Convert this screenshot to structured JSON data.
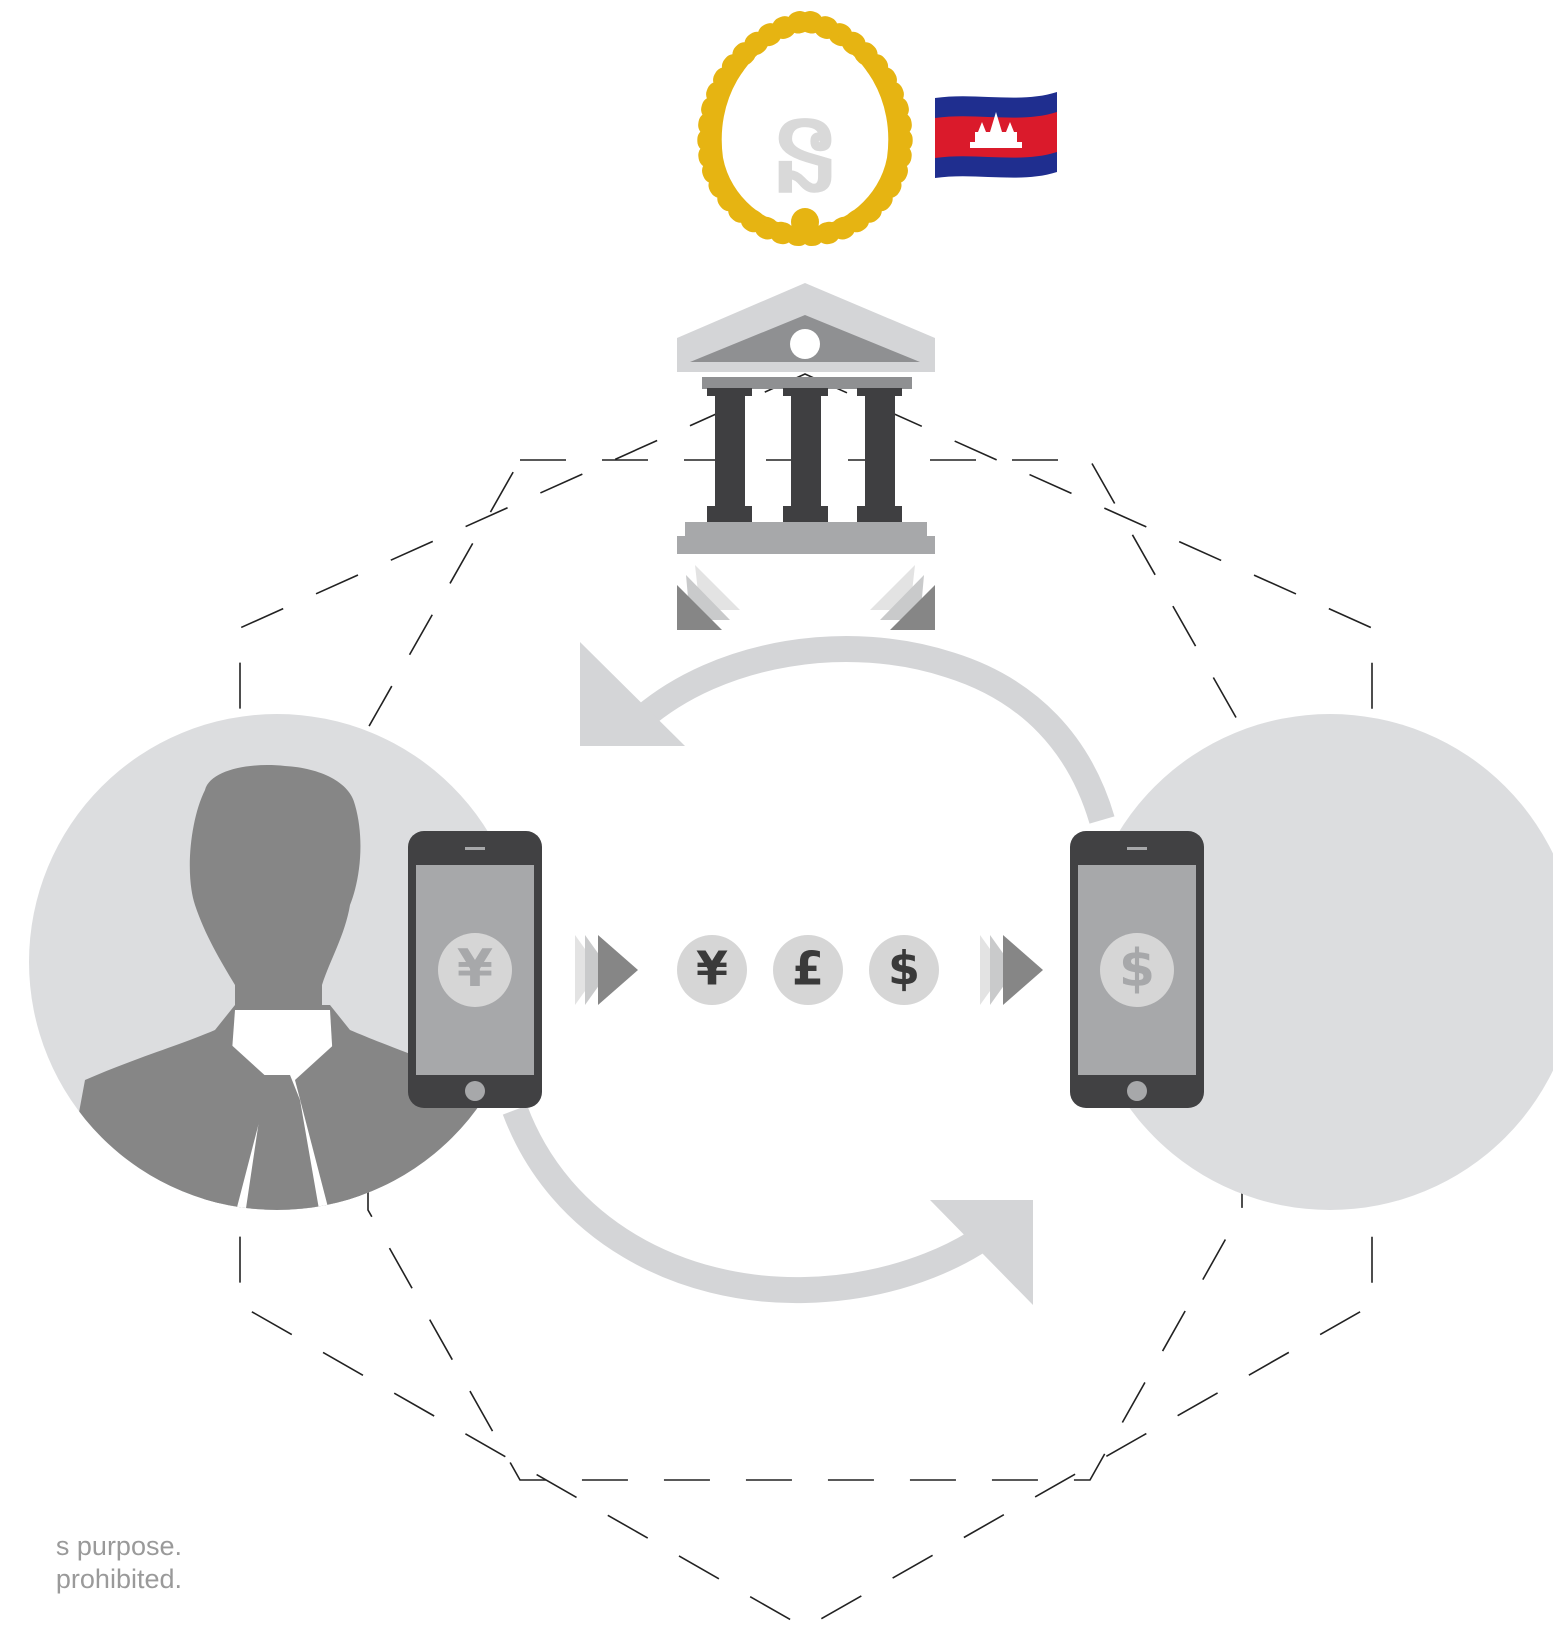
{
  "emblem": {
    "glyph": "ន",
    "name": "Cambodian seal emblem",
    "colors": {
      "wreath": "#E6B412",
      "glyph": "#D9D9D9"
    }
  },
  "flag": {
    "name": "flag-of-cambodia",
    "colors": {
      "blue": "#1F2E8F",
      "red": "#DA1A2B",
      "white": "#FFFFFF"
    }
  },
  "bank": {
    "icon": "bank-building-icon"
  },
  "sender": {
    "icon": "person-silhouette-icon",
    "phone_currency": "¥"
  },
  "receiver": {
    "icon": "person-silhouette-icon",
    "phone_currency": "$"
  },
  "currencies": [
    "¥",
    "£",
    "$"
  ],
  "colors": {
    "light_gray": "#D4D5D7",
    "circle_bg": "#DCDDDF",
    "silhouette": "#868686",
    "phone_body": "#414143",
    "phone_screen": "#A7A8AA",
    "coin": "#D6D6D6",
    "coin_text": "#3A3A3A",
    "dashed_line": "#222222"
  },
  "notice": {
    "line1": "s purpose.",
    "line2": "prohibited."
  }
}
